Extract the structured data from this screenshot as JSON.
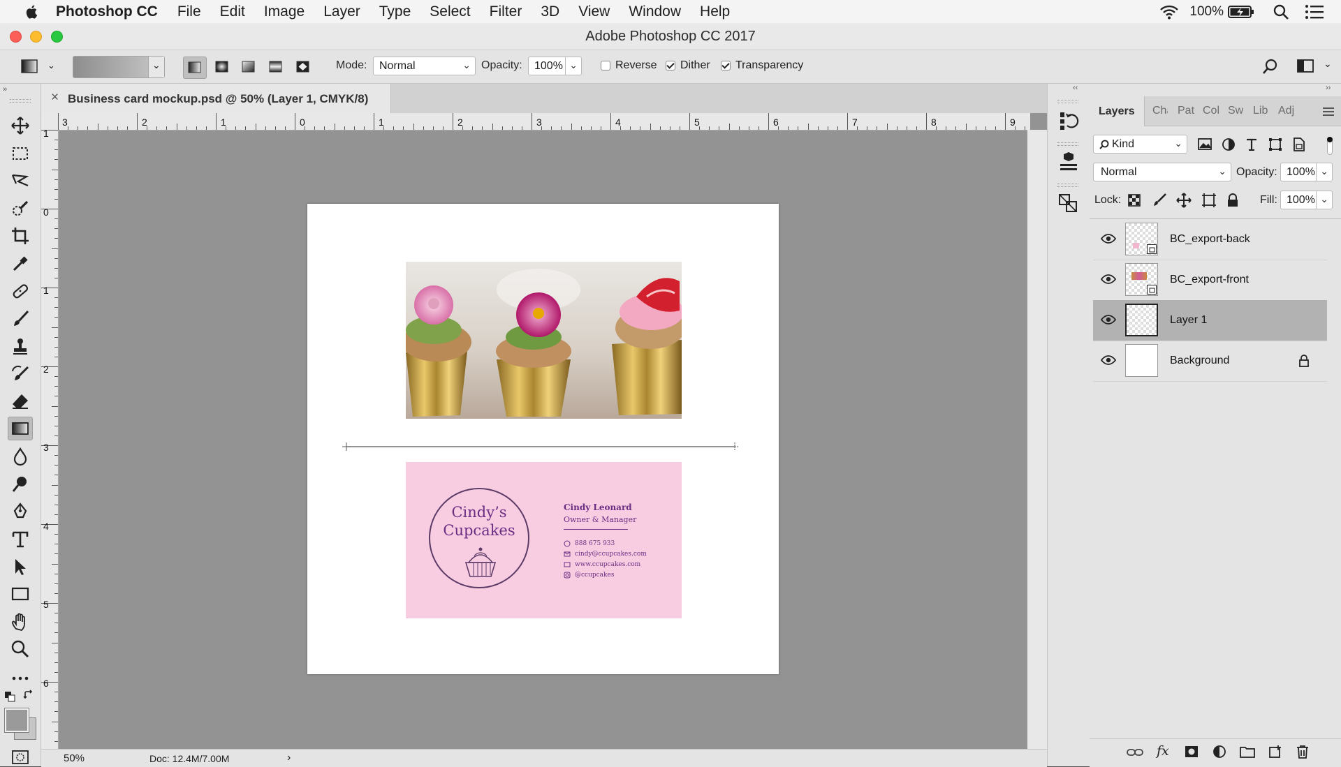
{
  "menubar": {
    "app_name": "Photoshop CC",
    "items": [
      "File",
      "Edit",
      "Image",
      "Layer",
      "Type",
      "Select",
      "Filter",
      "3D",
      "View",
      "Window",
      "Help"
    ],
    "battery": "100%"
  },
  "window": {
    "title": "Adobe Photoshop CC 2017"
  },
  "options": {
    "mode_label": "Mode:",
    "mode_value": "Normal",
    "opacity_label": "Opacity:",
    "opacity_value": "100%",
    "reverse_label": "Reverse",
    "reverse_checked": false,
    "dither_label": "Dither",
    "dither_checked": true,
    "transparency_label": "Transparency",
    "transparency_checked": true
  },
  "document": {
    "tab_title": "Business card mockup.psd @ 50% (Layer 1, CMYK/8)",
    "hruler_labels": [
      "3",
      "2",
      "1",
      "0",
      "1",
      "2",
      "3",
      "4",
      "5",
      "6",
      "7",
      "8",
      "9"
    ],
    "vruler_labels": [
      "1",
      "0",
      "1",
      "2",
      "3",
      "4",
      "5",
      "6"
    ]
  },
  "card": {
    "logo_line1": "Cindy’s",
    "logo_line2": "Cupcakes",
    "name": "Cindy Leonard",
    "role": "Owner & Manager",
    "phone": "888 675 933",
    "email": "cindy@ccupcakes.com",
    "website": "www.ccupcakes.com",
    "social": "@ccupcakes",
    "bg_color": "#f8cde2",
    "ink_color": "#6b2d82"
  },
  "status": {
    "zoom": "50%",
    "doc": "Doc: 12.4M/7.00M"
  },
  "panel": {
    "tabs": [
      "Layers",
      "Cha",
      "Pat",
      "Col",
      "Sw",
      "Lib",
      "Adj"
    ],
    "kind_label": "Kind",
    "blend_mode": "Normal",
    "opacity_label": "Opacity:",
    "opacity_value": "100%",
    "lock_label": "Lock:",
    "fill_label": "Fill:",
    "fill_value": "100%",
    "layers": [
      {
        "name": "BC_export-back",
        "selected": false,
        "locked": false
      },
      {
        "name": "BC_export-front",
        "selected": false,
        "locked": false
      },
      {
        "name": "Layer 1",
        "selected": true,
        "locked": false
      },
      {
        "name": "Background",
        "selected": false,
        "locked": true
      }
    ]
  }
}
